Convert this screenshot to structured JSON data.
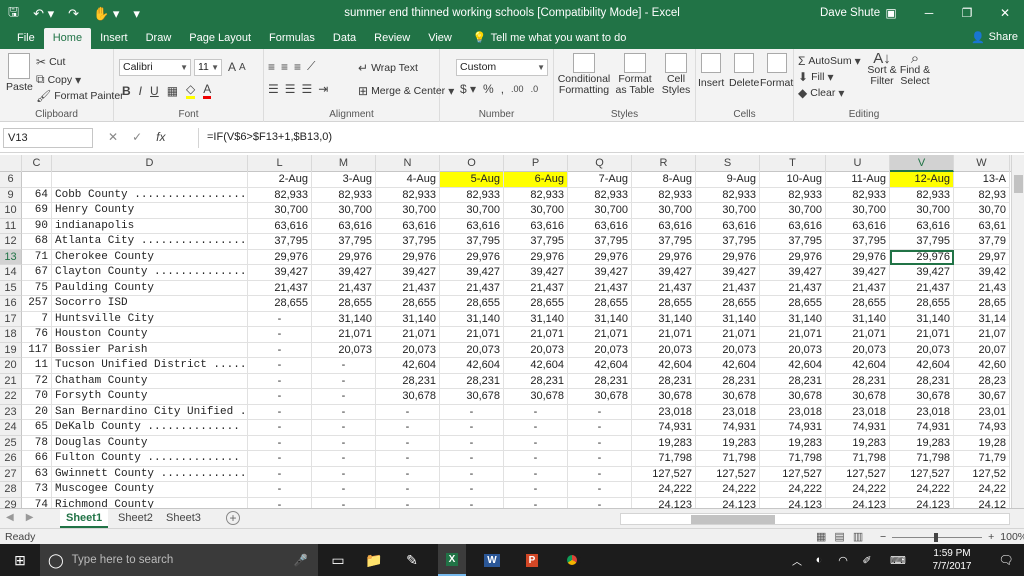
{
  "titlebar": {
    "title": "summer end thinned working schools  [Compatibility Mode]  -  Excel",
    "user": "Dave Shute",
    "qat": [
      "save-icon",
      "undo-icon",
      "redo-icon",
      "touch-mode-icon",
      "customize-icon"
    ],
    "window_buttons": [
      "ribbon-display-icon",
      "minimize-icon",
      "restore-icon",
      "close-icon"
    ]
  },
  "tabs": [
    "File",
    "Home",
    "Insert",
    "Draw",
    "Page Layout",
    "Formulas",
    "Data",
    "Review",
    "View"
  ],
  "active_tab": "Home",
  "tell_me": "Tell me what you want to do",
  "share": "Share",
  "ribbon": {
    "clipboard": {
      "label": "Clipboard",
      "paste": "Paste",
      "cut": "Cut",
      "copy": "Copy",
      "format_painter": "Format Painter"
    },
    "font": {
      "label": "Font",
      "name": "Calibri",
      "size": "11"
    },
    "alignment": {
      "label": "Alignment",
      "wrap": "Wrap Text",
      "merge": "Merge & Center"
    },
    "number": {
      "label": "Number",
      "format": "Custom"
    },
    "styles": {
      "label": "Styles",
      "conditional": "Conditional Formatting",
      "format_table": "Format as Table",
      "cell_styles": "Cell Styles"
    },
    "cells": {
      "label": "Cells",
      "insert": "Insert",
      "delete": "Delete",
      "format": "Format"
    },
    "editing": {
      "label": "Editing",
      "autosum": "AutoSum",
      "fill": "Fill",
      "clear": "Clear",
      "sort": "Sort & Filter",
      "find": "Find & Select"
    }
  },
  "formula_bar": {
    "name_box": "V13",
    "formula": "=IF(V$6>$F13+1,$B13,0)"
  },
  "grid": {
    "columns": [
      "C",
      "D",
      "L",
      "M",
      "N",
      "O",
      "P",
      "Q",
      "R",
      "S",
      "T",
      "U",
      "V",
      "W"
    ],
    "selected_column": "V",
    "date_headers": [
      "2-Aug",
      "3-Aug",
      "4-Aug",
      "5-Aug",
      "6-Aug",
      "7-Aug",
      "8-Aug",
      "9-Aug",
      "10-Aug",
      "11-Aug",
      "12-Aug",
      "13-A"
    ],
    "yellow_headers": [
      3,
      4,
      10
    ],
    "header_row": "6",
    "selected_row": "13",
    "rows": [
      {
        "n": "9",
        "c": "64",
        "d": "Cobb County ..................",
        "v": [
          "82,933",
          "82,933",
          "82,933",
          "82,933",
          "82,933",
          "82,933",
          "82,933",
          "82,933",
          "82,933",
          "82,933",
          "82,933",
          "82,93"
        ]
      },
      {
        "n": "10",
        "c": "69",
        "d": "Henry County",
        "v": [
          "30,700",
          "30,700",
          "30,700",
          "30,700",
          "30,700",
          "30,700",
          "30,700",
          "30,700",
          "30,700",
          "30,700",
          "30,700",
          "30,70"
        ]
      },
      {
        "n": "11",
        "c": "90",
        "d": "indianapolis",
        "v": [
          "63,616",
          "63,616",
          "63,616",
          "63,616",
          "63,616",
          "63,616",
          "63,616",
          "63,616",
          "63,616",
          "63,616",
          "63,616",
          "63,61"
        ]
      },
      {
        "n": "12",
        "c": "68",
        "d": "Atlanta City ..................",
        "v": [
          "37,795",
          "37,795",
          "37,795",
          "37,795",
          "37,795",
          "37,795",
          "37,795",
          "37,795",
          "37,795",
          "37,795",
          "37,795",
          "37,79"
        ]
      },
      {
        "n": "13",
        "c": "71",
        "d": "Cherokee County",
        "v": [
          "29,976",
          "29,976",
          "29,976",
          "29,976",
          "29,976",
          "29,976",
          "29,976",
          "29,976",
          "29,976",
          "29,976",
          "29,976",
          "29,97"
        ]
      },
      {
        "n": "14",
        "c": "67",
        "d": "Clayton County ..............",
        "v": [
          "39,427",
          "39,427",
          "39,427",
          "39,427",
          "39,427",
          "39,427",
          "39,427",
          "39,427",
          "39,427",
          "39,427",
          "39,427",
          "39,42"
        ]
      },
      {
        "n": "15",
        "c": "75",
        "d": "Paulding County",
        "v": [
          "21,437",
          "21,437",
          "21,437",
          "21,437",
          "21,437",
          "21,437",
          "21,437",
          "21,437",
          "21,437",
          "21,437",
          "21,437",
          "21,43"
        ]
      },
      {
        "n": "16",
        "c": "257",
        "d": "Socorro ISD",
        "v": [
          "28,655",
          "28,655",
          "28,655",
          "28,655",
          "28,655",
          "28,655",
          "28,655",
          "28,655",
          "28,655",
          "28,655",
          "28,655",
          "28,65"
        ]
      },
      {
        "n": "17",
        "c": "7",
        "d": "Huntsville City",
        "v": [
          "-",
          "31,140",
          "31,140",
          "31,140",
          "31,140",
          "31,140",
          "31,140",
          "31,140",
          "31,140",
          "31,140",
          "31,140",
          "31,14"
        ]
      },
      {
        "n": "18",
        "c": "76",
        "d": "Houston County",
        "v": [
          "-",
          "21,071",
          "21,071",
          "21,071",
          "21,071",
          "21,071",
          "21,071",
          "21,071",
          "21,071",
          "21,071",
          "21,071",
          "21,07"
        ]
      },
      {
        "n": "19",
        "c": "117",
        "d": "Bossier Parish",
        "v": [
          "-",
          "20,073",
          "20,073",
          "20,073",
          "20,073",
          "20,073",
          "20,073",
          "20,073",
          "20,073",
          "20,073",
          "20,073",
          "20,07"
        ]
      },
      {
        "n": "20",
        "c": "11",
        "d": "Tucson Unified District ......",
        "v": [
          "-",
          "-",
          "42,604",
          "42,604",
          "42,604",
          "42,604",
          "42,604",
          "42,604",
          "42,604",
          "42,604",
          "42,604",
          "42,60"
        ]
      },
      {
        "n": "21",
        "c": "72",
        "d": "Chatham County",
        "v": [
          "-",
          "-",
          "28,231",
          "28,231",
          "28,231",
          "28,231",
          "28,231",
          "28,231",
          "28,231",
          "28,231",
          "28,231",
          "28,23"
        ]
      },
      {
        "n": "22",
        "c": "70",
        "d": "Forsyth County",
        "v": [
          "-",
          "-",
          "30,678",
          "30,678",
          "30,678",
          "30,678",
          "30,678",
          "30,678",
          "30,678",
          "30,678",
          "30,678",
          "30,67"
        ]
      },
      {
        "n": "23",
        "c": "20",
        "d": "San Bernardino City Unified ..",
        "v": [
          "-",
          "-",
          "-",
          "-",
          "-",
          "-",
          "23,018",
          "23,018",
          "23,018",
          "23,018",
          "23,018",
          "23,01"
        ]
      },
      {
        "n": "24",
        "c": "65",
        "d": "DeKalb County ..............",
        "v": [
          "-",
          "-",
          "-",
          "-",
          "-",
          "-",
          "74,931",
          "74,931",
          "74,931",
          "74,931",
          "74,931",
          "74,93"
        ]
      },
      {
        "n": "25",
        "c": "78",
        "d": "Douglas County",
        "v": [
          "-",
          "-",
          "-",
          "-",
          "-",
          "-",
          "19,283",
          "19,283",
          "19,283",
          "19,283",
          "19,283",
          "19,28"
        ]
      },
      {
        "n": "26",
        "c": "66",
        "d": "Fulton County ..............",
        "v": [
          "-",
          "-",
          "-",
          "-",
          "-",
          "-",
          "71,798",
          "71,798",
          "71,798",
          "71,798",
          "71,798",
          "71,79"
        ]
      },
      {
        "n": "27",
        "c": "63",
        "d": "Gwinnett County ..............",
        "v": [
          "-",
          "-",
          "-",
          "-",
          "-",
          "-",
          "127,527",
          "127,527",
          "127,527",
          "127,527",
          "127,527",
          "127,52"
        ]
      },
      {
        "n": "28",
        "c": "73",
        "d": "Muscogee County",
        "v": [
          "-",
          "-",
          "-",
          "-",
          "-",
          "-",
          "24,222",
          "24,222",
          "24,222",
          "24,222",
          "24,222",
          "24,22"
        ]
      },
      {
        "n": "29",
        "c": "74",
        "d": "Richmond County",
        "v": [
          "-",
          "-",
          "-",
          "-",
          "-",
          "-",
          "24,123",
          "24,123",
          "24,123",
          "24,123",
          "24,123",
          "24,12"
        ]
      }
    ]
  },
  "sheets": [
    "Sheet1",
    "Sheet2",
    "Sheet3"
  ],
  "active_sheet": "Sheet1",
  "status": {
    "text": "Ready",
    "zoom": "100%"
  },
  "taskbar": {
    "search_placeholder": "Type here to search",
    "time": "1:59 PM",
    "date": "7/7/2017"
  },
  "colors": {
    "excel_green": "#217346",
    "highlight": "#ffff00"
  }
}
